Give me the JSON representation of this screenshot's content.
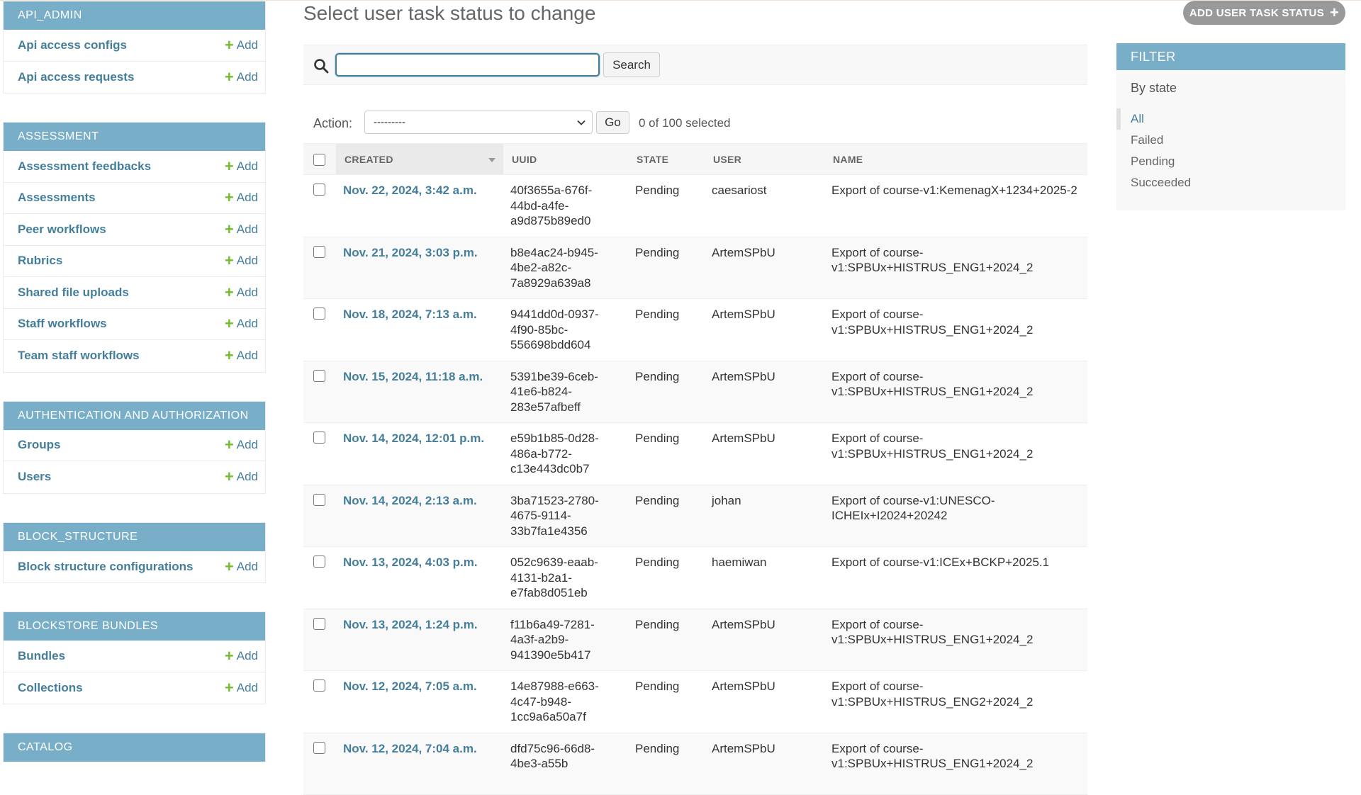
{
  "sidebar": {
    "modules": [
      {
        "caption": "API_ADMIN",
        "models": [
          {
            "name": "Api access configs",
            "add": "Add"
          },
          {
            "name": "Api access requests",
            "add": "Add"
          }
        ]
      },
      {
        "caption": "ASSESSMENT",
        "models": [
          {
            "name": "Assessment feedbacks",
            "add": "Add"
          },
          {
            "name": "Assessments",
            "add": "Add"
          },
          {
            "name": "Peer workflows",
            "add": "Add"
          },
          {
            "name": "Rubrics",
            "add": "Add"
          },
          {
            "name": "Shared file uploads",
            "add": "Add"
          },
          {
            "name": "Staff workflows",
            "add": "Add"
          },
          {
            "name": "Team staff workflows",
            "add": "Add"
          }
        ]
      },
      {
        "caption": "AUTHENTICATION AND AUTHORIZATION",
        "models": [
          {
            "name": "Groups",
            "add": "Add"
          },
          {
            "name": "Users",
            "add": "Add"
          }
        ]
      },
      {
        "caption": "BLOCK_STRUCTURE",
        "models": [
          {
            "name": "Block structure configurations",
            "add": "Add"
          }
        ]
      },
      {
        "caption": "BLOCKSTORE BUNDLES",
        "models": [
          {
            "name": "Bundles",
            "add": "Add"
          },
          {
            "name": "Collections",
            "add": "Add"
          }
        ]
      },
      {
        "caption": "CATALOG",
        "models": []
      }
    ]
  },
  "header": {
    "title": "Select user task status to change",
    "add_button": "ADD USER TASK STATUS"
  },
  "search": {
    "value": "",
    "button": "Search"
  },
  "actions": {
    "label": "Action:",
    "selected_option": "---------",
    "go": "Go",
    "counter": "0 of 100 selected"
  },
  "table": {
    "columns": [
      "CREATED",
      "UUID",
      "STATE",
      "USER",
      "NAME"
    ],
    "rows": [
      {
        "created": "Nov. 22, 2024, 3:42 a.m.",
        "uuid": "40f3655a-676f-44bd-a4fe-a9d875b89ed0",
        "state": "Pending",
        "user": "caesariost",
        "name": "Export of course-v1:KemenagX+1234+2025-2"
      },
      {
        "created": "Nov. 21, 2024, 3:03 p.m.",
        "uuid": "b8e4ac24-b945-4be2-a82c-7a8929a639a8",
        "state": "Pending",
        "user": "ArtemSPbU",
        "name": "Export of course-v1:SPBUx+HISTRUS_ENG1+2024_2"
      },
      {
        "created": "Nov. 18, 2024, 7:13 a.m.",
        "uuid": "9441dd0d-0937-4f90-85bc-556698bdd604",
        "state": "Pending",
        "user": "ArtemSPbU",
        "name": "Export of course-v1:SPBUx+HISTRUS_ENG1+2024_2"
      },
      {
        "created": "Nov. 15, 2024, 11:18 a.m.",
        "uuid": "5391be39-6ceb-41e6-b824-283e57afbeff",
        "state": "Pending",
        "user": "ArtemSPbU",
        "name": "Export of course-v1:SPBUx+HISTRUS_ENG1+2024_2"
      },
      {
        "created": "Nov. 14, 2024, 12:01 p.m.",
        "uuid": "e59b1b85-0d28-486a-b772-c13e443dc0b7",
        "state": "Pending",
        "user": "ArtemSPbU",
        "name": "Export of course-v1:SPBUx+HISTRUS_ENG1+2024_2"
      },
      {
        "created": "Nov. 14, 2024, 2:13 a.m.",
        "uuid": "3ba71523-2780-4675-9114-33b7fa1e4356",
        "state": "Pending",
        "user": "johan",
        "name": "Export of course-v1:UNESCO-ICHEIx+I2024+20242"
      },
      {
        "created": "Nov. 13, 2024, 4:03 p.m.",
        "uuid": "052c9639-eaab-4131-b2a1-e7fab8d051eb",
        "state": "Pending",
        "user": "haemiwan",
        "name": "Export of course-v1:ICEx+BCKP+2025.1"
      },
      {
        "created": "Nov. 13, 2024, 1:24 p.m.",
        "uuid": "f11b6a49-7281-4a3f-a2b9-941390e5b417",
        "state": "Pending",
        "user": "ArtemSPbU",
        "name": "Export of course-v1:SPBUx+HISTRUS_ENG1+2024_2"
      },
      {
        "created": "Nov. 12, 2024, 7:05 a.m.",
        "uuid": "14e87988-e663-4c47-b948-1cc9a6a50a7f",
        "state": "Pending",
        "user": "ArtemSPbU",
        "name": "Export of course-v1:SPBUx+HISTRUS_ENG2+2024_2"
      },
      {
        "created": "Nov. 12, 2024, 7:04 a.m.",
        "uuid": "dfd75c96-66d8-4be3-a55b",
        "state": "Pending",
        "user": "ArtemSPbU",
        "name": "Export of course-v1:SPBUx+HISTRUS_ENG1+2024_2"
      }
    ]
  },
  "filter": {
    "header": "FILTER",
    "subtitle": "By state",
    "options": [
      "All",
      "Failed",
      "Pending",
      "Succeeded"
    ],
    "selected": "All"
  },
  "colors": {
    "module_header": "#79aec8",
    "link": "#447e9b",
    "add_plus": "#70bf2b",
    "add_button_bg": "#999999"
  },
  "icons": {
    "search": "search-icon",
    "add": "plus-icon",
    "select": "chevron-down-icon",
    "sort": "sort-desc-icon"
  }
}
